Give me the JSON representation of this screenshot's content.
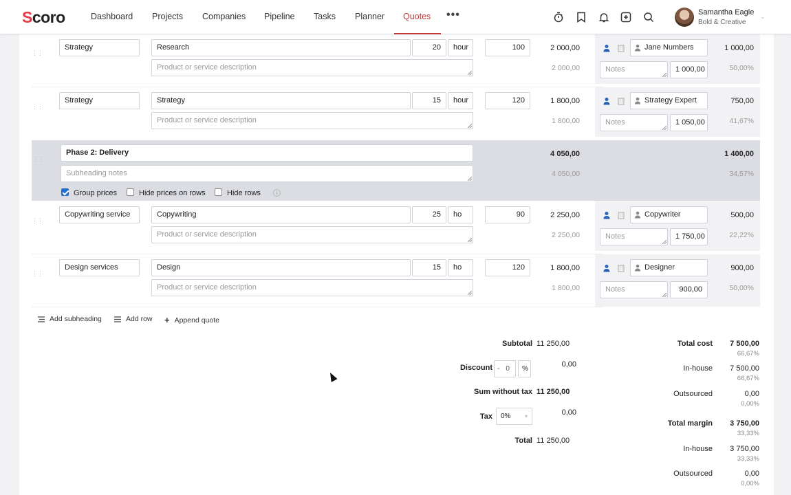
{
  "nav": {
    "logo_s": "S",
    "logo_rest": "coro",
    "items": [
      "Dashboard",
      "Projects",
      "Companies",
      "Pipeline",
      "Tasks",
      "Planner",
      "Quotes"
    ],
    "more": "•••",
    "user_name": "Samantha Eagle",
    "user_company": "Bold & Creative",
    "chevron": "⌄"
  },
  "rows": [
    {
      "product": "Strategy",
      "name": "Research",
      "qty": "20",
      "unit": "hour",
      "price": "100",
      "sum": "2 000,00",
      "sum_sub": "2 000,00",
      "resource": "Jane Numbers",
      "cost": "1 000,00",
      "cost_input": "1 000,00",
      "margin_pct": "50,00%",
      "desc_placeholder": "Product or service description",
      "notes_placeholder": "Notes"
    },
    {
      "product": "Strategy",
      "name": "Strategy",
      "qty": "15",
      "unit": "hour",
      "price": "120",
      "sum": "1 800,00",
      "sum_sub": "1 800,00",
      "resource": "Strategy Expert",
      "cost": "750,00",
      "cost_input": "1 050,00",
      "margin_pct": "41,67%",
      "desc_placeholder": "Product or service description",
      "notes_placeholder": "Notes"
    },
    {
      "product": "Copywriting service",
      "name": "Copywriting",
      "qty": "25",
      "unit": "ho",
      "price": "90",
      "sum": "2 250,00",
      "sum_sub": "2 250,00",
      "resource": "Copywriter",
      "cost": "500,00",
      "cost_input": "1 750,00",
      "margin_pct": "22,22%",
      "desc_placeholder": "Product or service description",
      "notes_placeholder": "Notes"
    },
    {
      "product": "Design services",
      "name": "Design",
      "qty": "15",
      "unit": "ho",
      "price": "120",
      "sum": "1 800,00",
      "sum_sub": "1 800,00",
      "resource": "Designer",
      "cost": "900,00",
      "cost_input": "900,00",
      "margin_pct": "50,00%",
      "desc_placeholder": "Product or service description",
      "notes_placeholder": "Notes"
    }
  ],
  "phase": {
    "title": "Phase 2: Delivery",
    "notes_placeholder": "Subheading notes",
    "sum": "4 050,00",
    "sum_sub": "4 050,00",
    "cost": "1 400,00",
    "margin_pct": "34,57%",
    "group_prices_label": "Group prices",
    "hide_prices_label": "Hide prices on rows",
    "hide_rows_label": "Hide rows",
    "info": "i"
  },
  "actions": {
    "add_subheading": "Add subheading",
    "add_row": "Add row",
    "append_quote": "Append quote",
    "plus": "+"
  },
  "totals": {
    "subtotal_label": "Subtotal",
    "subtotal": "11 250,00",
    "discount_label": "Discount",
    "discount_minus": "-",
    "discount_value": "0",
    "discount_unit": "%",
    "discount_amount": "0,00",
    "sum_without_tax_label": "Sum without tax",
    "sum_without_tax": "11 250,00",
    "tax_label": "Tax",
    "tax_value": "0%",
    "tax_caret": "▾",
    "tax_amount": "0,00",
    "total_label": "Total",
    "total": "11 250,00"
  },
  "costs": {
    "total_cost_label": "Total cost",
    "total_cost": "7 500,00",
    "total_cost_pct": "66,67%",
    "inhouse_label": "In-house",
    "inhouse": "7 500,00",
    "inhouse_pct": "66,67%",
    "outsourced_label": "Outsourced",
    "outsourced": "0,00",
    "outsourced_pct": "0,00%",
    "total_margin_label": "Total margin",
    "total_margin": "3 750,00",
    "total_margin_pct": "33,33%",
    "margin_inhouse_label": "In-house",
    "margin_inhouse": "3 750,00",
    "margin_inhouse_pct": "33,33%",
    "margin_outsourced_label": "Outsourced",
    "margin_outsourced": "0,00",
    "margin_outsourced_pct": "0,00%"
  },
  "colors": {
    "accent": "#c23838",
    "link_blue": "#2b63b6",
    "checkbox_blue": "#1f6fd1",
    "phase_bg": "#dcdde2"
  },
  "icons": [
    "timer-icon",
    "bookmark-icon",
    "bell-icon",
    "add-icon",
    "search-icon",
    "person-icon",
    "building-icon",
    "drag-handle-icon",
    "list-icon",
    "plus-icon",
    "info-icon"
  ]
}
